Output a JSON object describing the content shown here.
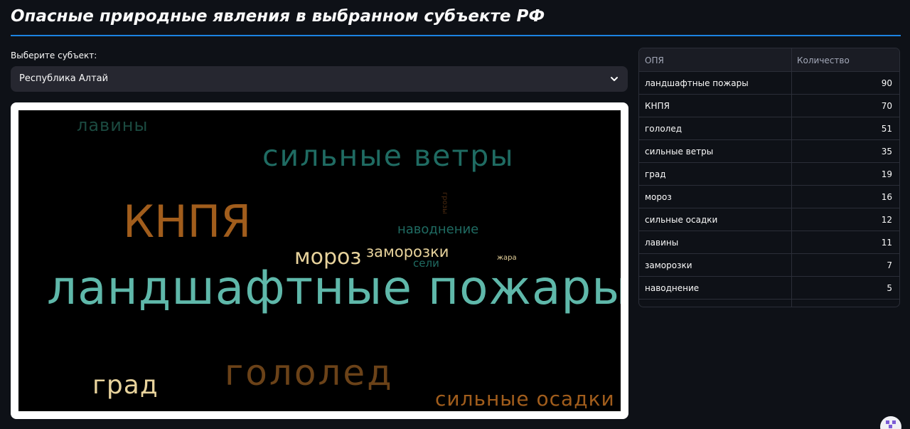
{
  "header": {
    "title": "Опасные природные явления в выбранном субъекте РФ"
  },
  "selector": {
    "label": "Выберите субъект:",
    "value": "Республика Алтай",
    "icon": "chevron-down-icon"
  },
  "wordcloud": {
    "background": "#000000",
    "frame_color": "#ffffff",
    "words": [
      {
        "text": "ландшафтные пожары",
        "color": "#5fb8aa"
      },
      {
        "text": "КНПЯ",
        "color": "#a15d1c"
      },
      {
        "text": "гололед",
        "color": "#6b4218"
      },
      {
        "text": "сильные ветры",
        "color": "#1f6b62"
      },
      {
        "text": "град",
        "color": "#e8d39c"
      },
      {
        "text": "мороз",
        "color": "#e8d39c"
      },
      {
        "text": "сильные осадки",
        "color": "#a15d1c"
      },
      {
        "text": "лавины",
        "color": "#1b4a40"
      },
      {
        "text": "заморозки",
        "color": "#e8d39c"
      },
      {
        "text": "наводнение",
        "color": "#1f6b62"
      },
      {
        "text": "сели",
        "color": "#1f6b62"
      },
      {
        "text": "грозы",
        "color": "#4a2a10"
      },
      {
        "text": "жара",
        "color": "#e8d39c"
      }
    ]
  },
  "table": {
    "columns": [
      "ОПЯ",
      "Количество"
    ],
    "rows": [
      {
        "name": "ландшафтные пожары",
        "count": "90"
      },
      {
        "name": "КНПЯ",
        "count": "70"
      },
      {
        "name": "гололед",
        "count": "51"
      },
      {
        "name": "сильные ветры",
        "count": "35"
      },
      {
        "name": "град",
        "count": "19"
      },
      {
        "name": "мороз",
        "count": "16"
      },
      {
        "name": "сильные осадки",
        "count": "12"
      },
      {
        "name": "лавины",
        "count": "11"
      },
      {
        "name": "заморозки",
        "count": "7"
      },
      {
        "name": "наводнение",
        "count": "5"
      }
    ]
  },
  "colors": {
    "background": "#0e1117",
    "accent_line": "#1c83e1",
    "select_bg": "#262730"
  },
  "corner_widget": {
    "icon": "streamlit-app-icon"
  }
}
